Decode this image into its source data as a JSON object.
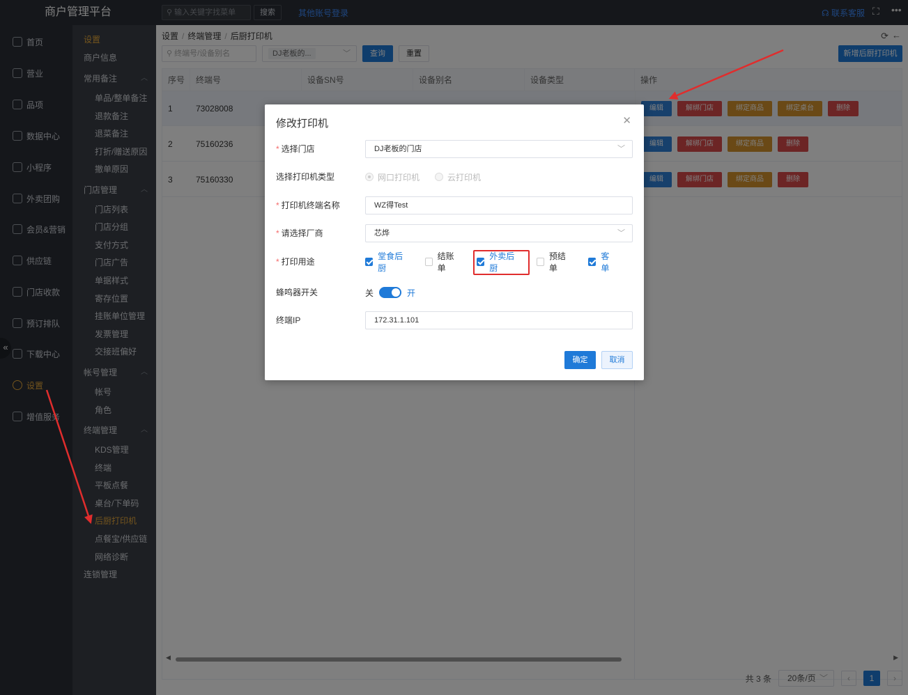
{
  "app": {
    "title": "商户管理平台"
  },
  "topbar": {
    "search_placeholder": "输入关键字找菜单",
    "search_btn": "搜索",
    "other_login": "其他账号登录",
    "contact": "联系客服"
  },
  "nav": {
    "items": [
      {
        "label": "首页"
      },
      {
        "label": "营业"
      },
      {
        "label": "品项"
      },
      {
        "label": "数据中心"
      },
      {
        "label": "小程序"
      },
      {
        "label": "外卖团购"
      },
      {
        "label": "会员&营销"
      },
      {
        "label": "供应链"
      },
      {
        "label": "门店收款"
      },
      {
        "label": "预订排队"
      },
      {
        "label": "下载中心"
      },
      {
        "label": "设置"
      },
      {
        "label": "增值服务"
      }
    ]
  },
  "submenu": {
    "items": [
      {
        "label": "设置"
      },
      {
        "label": "商户信息"
      },
      {
        "label": "常用备注"
      },
      {
        "label": "单品/整单备注"
      },
      {
        "label": "退款备注"
      },
      {
        "label": "退菜备注"
      },
      {
        "label": "打折/赠送原因"
      },
      {
        "label": "撤单原因"
      },
      {
        "label": "门店管理"
      },
      {
        "label": "门店列表"
      },
      {
        "label": "门店分组"
      },
      {
        "label": "支付方式"
      },
      {
        "label": "门店广告"
      },
      {
        "label": "单据样式"
      },
      {
        "label": "寄存位置"
      },
      {
        "label": "挂账单位管理"
      },
      {
        "label": "发票管理"
      },
      {
        "label": "交接班偏好"
      },
      {
        "label": "帐号管理"
      },
      {
        "label": "帐号"
      },
      {
        "label": "角色"
      },
      {
        "label": "终端管理"
      },
      {
        "label": "KDS管理"
      },
      {
        "label": "终端"
      },
      {
        "label": "平板点餐"
      },
      {
        "label": "桌台/下单码"
      },
      {
        "label": "后厨打印机"
      },
      {
        "label": "点餐宝/供应链"
      },
      {
        "label": "网络诊断"
      },
      {
        "label": "连锁管理"
      }
    ]
  },
  "breadcrumb": [
    "设置",
    "终端管理",
    "后厨打印机"
  ],
  "filter": {
    "placeholder": "终端号/设备别名",
    "store_chip": "DJ老板的...",
    "query_btn": "查询",
    "reset_btn": "重置",
    "add_btn": "新增后厨打印机"
  },
  "table": {
    "headers": [
      "序号",
      "终端号",
      "设备SN号",
      "设备别名",
      "设备类型",
      "操作"
    ],
    "rows": [
      {
        "no": "1",
        "terminal": "73028008"
      },
      {
        "no": "2",
        "terminal": "75160236"
      },
      {
        "no": "3",
        "terminal": "75160330"
      }
    ],
    "ops": {
      "edit": "编辑",
      "unbind_store": "解绑门店",
      "bind_product": "绑定商品",
      "bind_table": "绑定桌台",
      "delete": "删除"
    }
  },
  "pager": {
    "total": "共 3 条",
    "page_size": "20条/页",
    "current": "1"
  },
  "dialog": {
    "title": "修改打印机",
    "store_label": "选择门店",
    "store_value": "DJ老板的门店",
    "type_label": "选择打印机类型",
    "type_options": [
      "网口打印机",
      "云打印机"
    ],
    "name_label": "打印机终端名称",
    "name_value": "WZ得Test",
    "vendor_label": "请选择厂商",
    "vendor_value": "芯烨",
    "usage_label": "打印用途",
    "usage_options": [
      {
        "label": "堂食后厨",
        "checked": true
      },
      {
        "label": "结账单",
        "checked": false
      },
      {
        "label": "外卖后厨",
        "checked": true
      },
      {
        "label": "预结单",
        "checked": false
      },
      {
        "label": "客单",
        "checked": true
      }
    ],
    "buzzer_label": "蜂鸣器开关",
    "buzzer_off": "关",
    "buzzer_on": "开",
    "ip_label": "终端IP",
    "ip_value": "172.31.1.101",
    "ok_btn": "确定",
    "cancel_btn": "取消"
  }
}
